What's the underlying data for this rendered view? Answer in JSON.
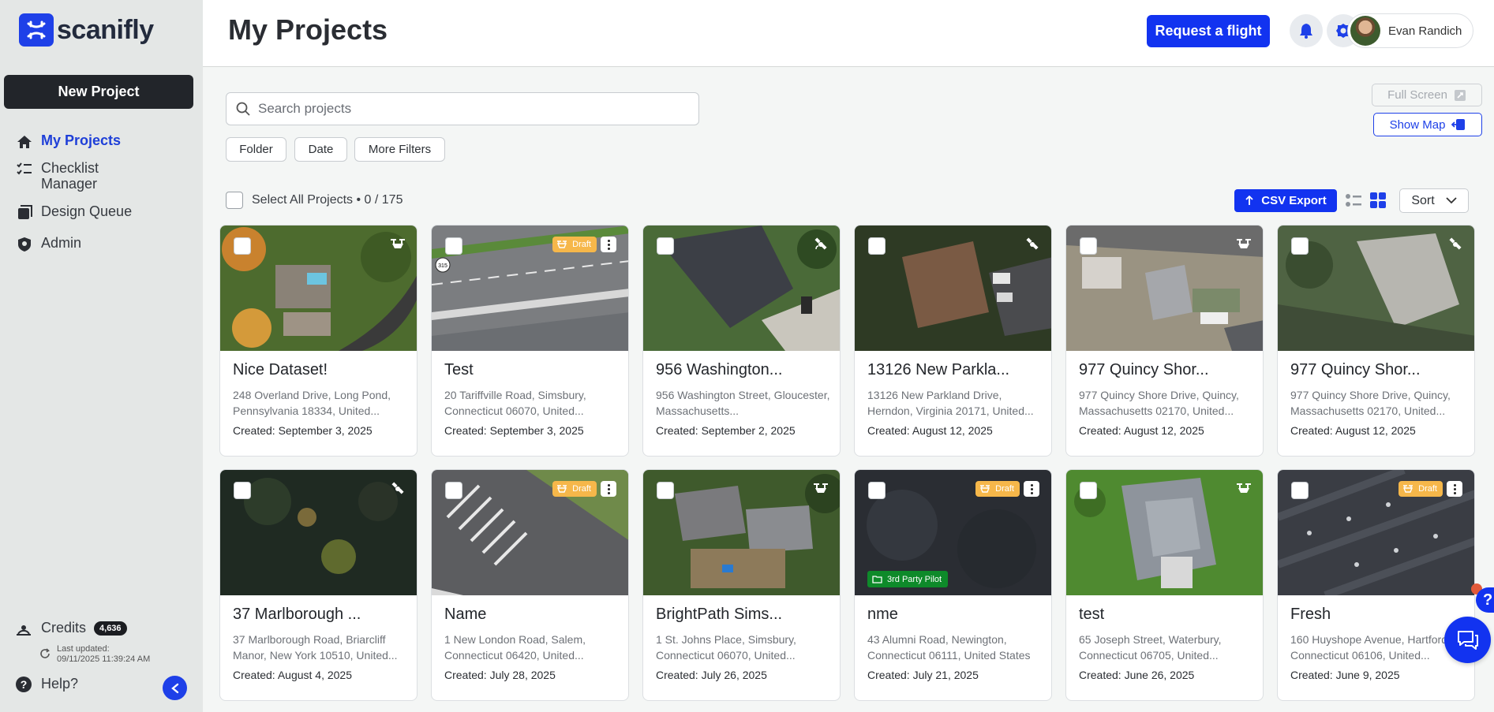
{
  "app": {
    "name": "scanifly",
    "brand_color": "#1e40e8"
  },
  "sidebar": {
    "new_project_label": "New Project",
    "items": [
      {
        "label": "My Projects",
        "icon": "home-icon",
        "active": true
      },
      {
        "label": "Checklist Manager",
        "icon": "checklist-icon"
      },
      {
        "label": "Design Queue",
        "icon": "design-queue-icon"
      },
      {
        "label": "Admin",
        "icon": "shield-icon"
      }
    ],
    "credits_label": "Credits",
    "credits_count": "4,636",
    "last_updated_label": "Last updated:",
    "last_updated_value": "09/11/2025 11:39:24 AM",
    "help_label": "Help?"
  },
  "header": {
    "title": "My Projects",
    "request_flight_label": "Request a flight",
    "user_name": "Evan Randich"
  },
  "search": {
    "placeholder": "Search projects",
    "value": ""
  },
  "filters": [
    "Folder",
    "Date",
    "More Filters"
  ],
  "fullscreen_label": "Full Screen",
  "show_map_label": "Show Map",
  "select_all_label": "Select All Projects • 0 / 175",
  "csv_export_label": "CSV Export",
  "sort_label": "Sort",
  "projects": [
    {
      "title": "Nice Dataset!",
      "address": "248 Overland Drive, Long Pond, Pennsylvania 18334, United...",
      "created": "Created: September 3, 2025",
      "status_icon": "drone-icon"
    },
    {
      "title": "Test",
      "address": "20 Tariffville Road, Simsbury, Connecticut 06070, United...",
      "created": "Created: September 3, 2025",
      "badge": "Draft"
    },
    {
      "title": "956 Washington...",
      "address": "956 Washington Street, Gloucester, Massachusetts...",
      "created": "Created: September 2, 2025",
      "status_icon": "satellite-icon"
    },
    {
      "title": "13126 New Parkla...",
      "address": "13126 New Parkland Drive, Herndon, Virginia 20171, United...",
      "created": "Created: August 12, 2025",
      "status_icon": "satellite-icon"
    },
    {
      "title": "977 Quincy Shor...",
      "address": "977 Quincy Shore Drive, Quincy, Massachusetts 02170, United...",
      "created": "Created: August 12, 2025",
      "status_icon": "drone-icon"
    },
    {
      "title": "977 Quincy Shor...",
      "address": "977 Quincy Shore Drive, Quincy, Massachusetts 02170, United...",
      "created": "Created: August 12, 2025",
      "status_icon": "satellite-icon"
    },
    {
      "title": "37 Marlborough ...",
      "address": "37 Marlborough Road, Briarcliff Manor, New York 10510, United...",
      "created": "Created: August 4, 2025",
      "status_icon": "satellite-icon"
    },
    {
      "title": "Name",
      "address": "1 New London Road, Salem, Connecticut 06420, United...",
      "created": "Created: July 28, 2025",
      "badge": "Draft"
    },
    {
      "title": "BrightPath Sims...",
      "address": "1 St. Johns Place, Simsbury, Connecticut 06070, United...",
      "created": "Created: July 26, 2025",
      "status_icon": "drone-icon"
    },
    {
      "title": "nme",
      "address": "43 Alumni Road, Newington, Connecticut 06111, United States",
      "created": "Created: July 21, 2025",
      "badge": "Draft",
      "pilot_tag": "3rd Party Pilot"
    },
    {
      "title": "test",
      "address": "65 Joseph Street, Waterbury, Connecticut 06705, United...",
      "created": "Created: June 26, 2025",
      "status_icon": "drone-icon"
    },
    {
      "title": "Fresh",
      "address": "160 Huyshope Avenue, Hartford, Connecticut 06106, United...",
      "created": "Created: June 9, 2025",
      "badge": "Draft"
    }
  ],
  "colors": {
    "draft": "#f6b74a",
    "pilot": "#0e8a2a",
    "primary_button": "#1233f0"
  }
}
